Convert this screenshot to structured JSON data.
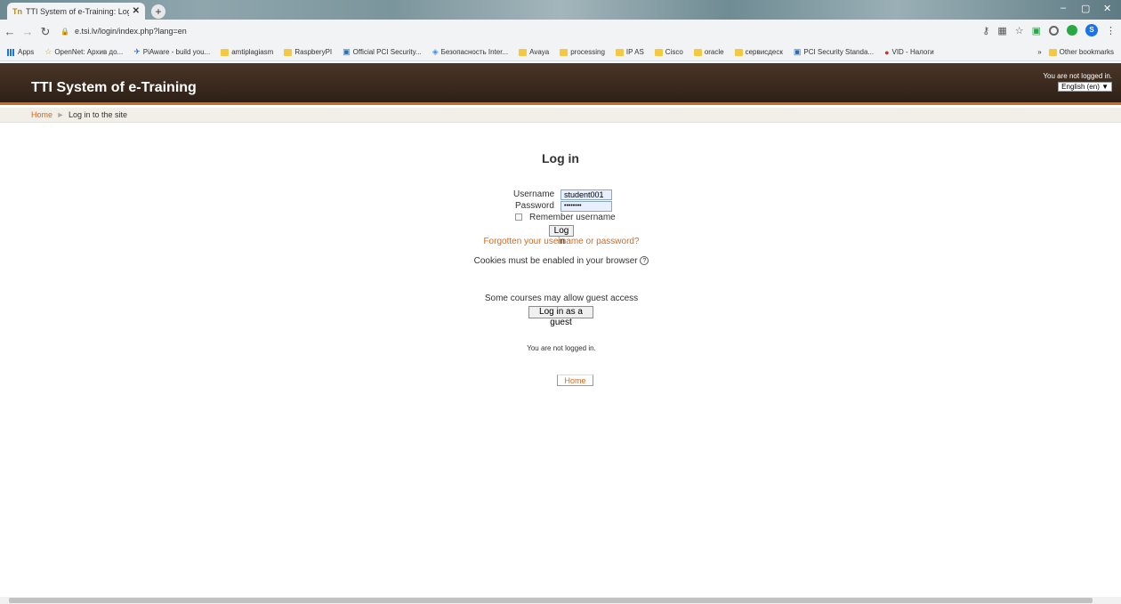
{
  "browser": {
    "tab_title": "TTI System of e-Training: Log in",
    "url": "e.tsi.lv/login/index.php?lang=en",
    "new_tab": "+",
    "bookmarks": [
      {
        "label": "Apps",
        "icon": "apps-grid-icon"
      },
      {
        "label": "OpenNet: Архив до...",
        "icon": "star-icon"
      },
      {
        "label": "PiAware - build you...",
        "icon": "plane-icon"
      },
      {
        "label": "amtiplagiasm",
        "icon": "folder-icon"
      },
      {
        "label": "RaspberyPI",
        "icon": "folder-icon"
      },
      {
        "label": "Official PCI Security...",
        "icon": "pci-icon"
      },
      {
        "label": "Безопасность Inter...",
        "icon": "diamond-icon"
      },
      {
        "label": "Avaya",
        "icon": "folder-icon"
      },
      {
        "label": "processing",
        "icon": "folder-icon"
      },
      {
        "label": "IP AS",
        "icon": "folder-icon"
      },
      {
        "label": "Cisco",
        "icon": "folder-icon"
      },
      {
        "label": "oracle",
        "icon": "folder-icon"
      },
      {
        "label": "сервисдеск",
        "icon": "folder-icon"
      },
      {
        "label": "PCI Security Standa...",
        "icon": "pci-icon"
      },
      {
        "label": "VID - Налоги",
        "icon": "hat-icon"
      }
    ],
    "other_bookmarks": "Other bookmarks",
    "more_bookmarks": "»",
    "profile_initial": "S"
  },
  "header": {
    "site_title": "TTI System of e-Training",
    "login_info": "You are not logged in.",
    "language": "English (en) ▼"
  },
  "breadcrumb": {
    "home": "Home",
    "separator": "►",
    "current": "Log in to the site"
  },
  "login": {
    "title": "Log in",
    "username_label": "Username",
    "username_value": "student001",
    "password_label": "Password",
    "password_value": "••••••••",
    "remember_label": "Remember username",
    "login_button": "Log in",
    "forgot_link": "Forgotten your username or password?",
    "cookies_text": "Cookies must be enabled in your browser",
    "guest_info": "Some courses may allow guest access",
    "guest_button": "Log in as a guest"
  },
  "footer": {
    "not_logged": "You are not logged in.",
    "home_button": "Home"
  },
  "colors": {
    "accent": "#d06a22",
    "header_bg": "#3b2a1e"
  }
}
